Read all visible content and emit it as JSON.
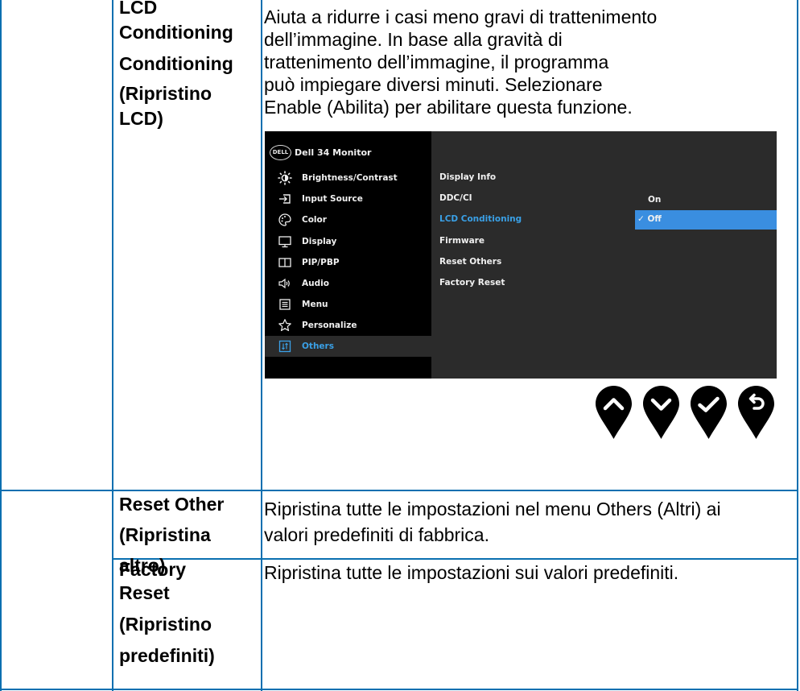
{
  "rows": [
    {
      "label_lines": [
        "LCD",
        "Conditioning",
        "Conditioning",
        "(Ripristino",
        "LCD)"
      ],
      "description_lines": [
        "Aiuta a ridurre i casi meno gravi di trattenimento",
        "dell’immagine. In base alla gravità di",
        "trattenimento dell’immagine, il programma",
        "può impiegare diversi minuti. Selezionare",
        "Enable (Abilita) per abilitare questa funzione."
      ]
    },
    {
      "label_lines": [
        "Reset Other",
        "(Ripristina",
        "altro)"
      ],
      "description_lines": [
        "Ripristina tutte le impostazioni nel menu Others (Altri) ai",
        "valori predefiniti di fabbrica."
      ]
    },
    {
      "label_lines": [
        "Factory",
        "Reset",
        "(Ripristino",
        "predefiniti)"
      ],
      "description_lines": [
        "Ripristina tutte le impostazioni sui valori predefiniti."
      ]
    }
  ],
  "osd": {
    "logo_text": "DELL",
    "title": "Dell 34 Monitor",
    "menu": [
      {
        "label": "Brightness/Contrast",
        "icon": "brightness-icon",
        "active": false
      },
      {
        "label": "Input Source",
        "icon": "input-source-icon",
        "active": false
      },
      {
        "label": "Color",
        "icon": "color-palette-icon",
        "active": false
      },
      {
        "label": "Display",
        "icon": "display-monitor-icon",
        "active": false
      },
      {
        "label": "PIP/PBP",
        "icon": "pip-pbp-icon",
        "active": false
      },
      {
        "label": "Audio",
        "icon": "speaker-icon",
        "active": false
      },
      {
        "label": "Menu",
        "icon": "menu-list-icon",
        "active": false
      },
      {
        "label": "Personalize",
        "icon": "star-icon",
        "active": false
      },
      {
        "label": "Others",
        "icon": "others-icon",
        "active": true
      }
    ],
    "submenu": [
      "Display Info",
      "DDC/CI",
      "LCD Conditioning",
      "Firmware",
      "Reset Others",
      "Factory Reset"
    ],
    "submenu_active": "LCD Conditioning",
    "options": {
      "on": "On",
      "off": "✓ Off",
      "selected": "Off"
    },
    "colors": {
      "bg": "#000000",
      "panel": "#2b2b2b",
      "accent": "#3aa0e6",
      "highlight": "#3a8ee0",
      "border": "#0a6fb0"
    }
  },
  "buttons": [
    {
      "name": "up-button",
      "icon": "chevron-up-icon"
    },
    {
      "name": "down-button",
      "icon": "chevron-down-icon"
    },
    {
      "name": "confirm-button",
      "icon": "check-icon"
    },
    {
      "name": "back-button",
      "icon": "back-arrow-icon"
    }
  ]
}
